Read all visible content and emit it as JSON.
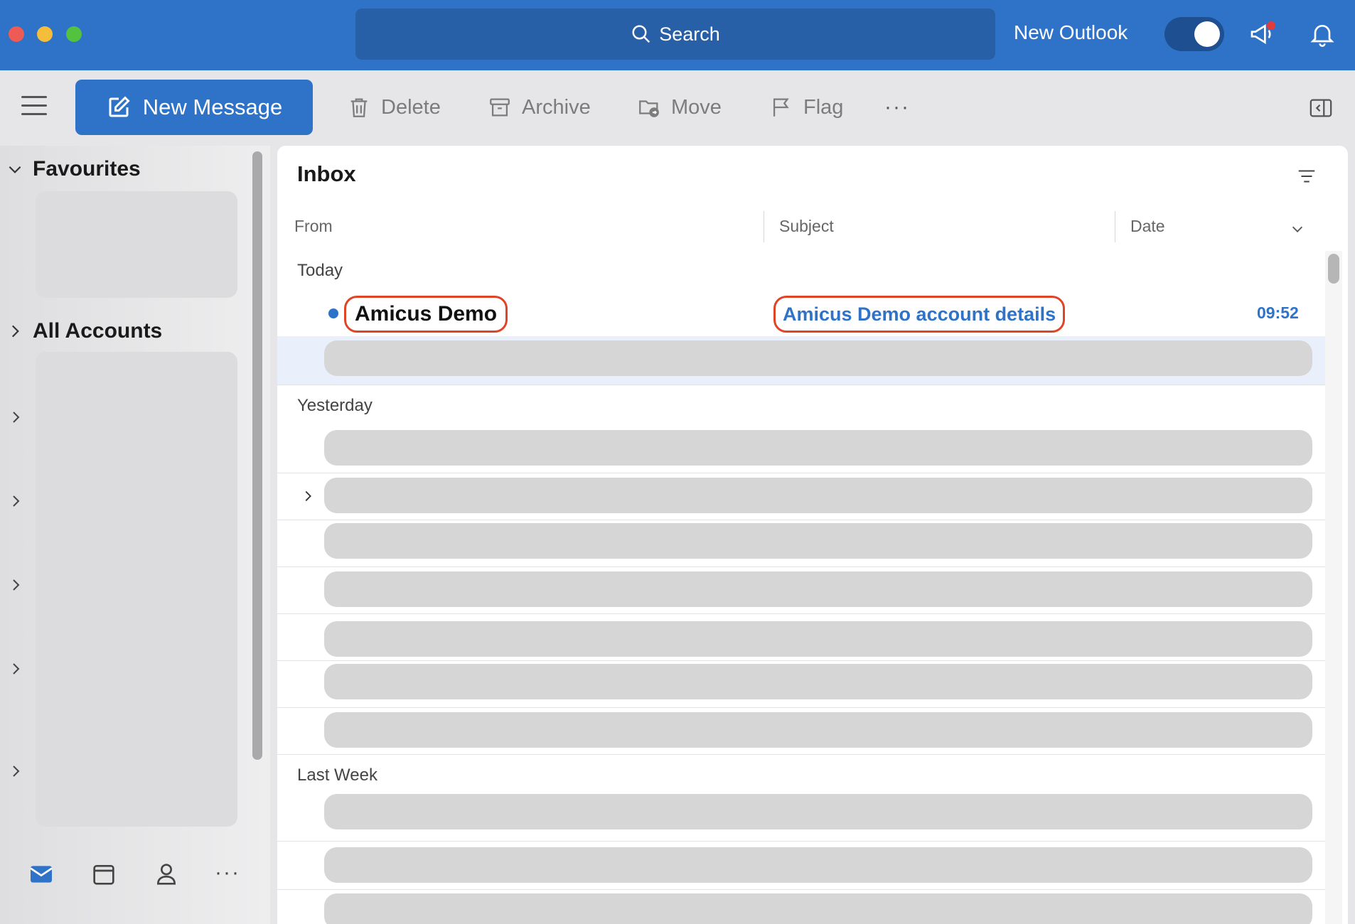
{
  "titlebar": {
    "search_label": "Search",
    "new_outlook_label": "New Outlook"
  },
  "toolbar": {
    "new_message_label": "New Message",
    "delete_label": "Delete",
    "archive_label": "Archive",
    "move_label": "Move",
    "flag_label": "Flag",
    "more_label": "···"
  },
  "sidebar": {
    "favourites_label": "Favourites",
    "all_accounts_label": "All Accounts",
    "more_label": "···"
  },
  "inbox": {
    "title": "Inbox",
    "columns": {
      "from": "From",
      "subject": "Subject",
      "date": "Date"
    },
    "groups": {
      "today": "Today",
      "yesterday": "Yesterday",
      "last_week": "Last Week"
    },
    "highlighted_message": {
      "sender": "Amicus Demo",
      "subject": "Amicus Demo account details",
      "time": "09:52"
    }
  },
  "colors": {
    "accent": "#2f73c9",
    "highlight_outline": "#e04426"
  }
}
